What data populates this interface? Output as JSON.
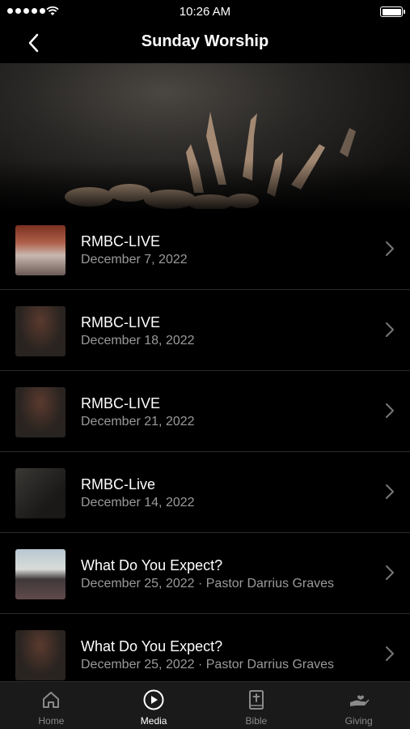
{
  "status": {
    "time": "10:26 AM"
  },
  "nav": {
    "title": "Sunday Worship"
  },
  "items": [
    {
      "title": "RMBC-LIVE",
      "subtitle": "December 7, 2022",
      "thumb": "church"
    },
    {
      "title": "RMBC-LIVE",
      "subtitle": "December 18, 2022",
      "thumb": "lights"
    },
    {
      "title": "RMBC-LIVE",
      "subtitle": "December 21, 2022",
      "thumb": "lights"
    },
    {
      "title": "RMBC-Live",
      "subtitle": "December 14, 2022",
      "thumb": "hands"
    },
    {
      "title": "What Do You Expect?",
      "subtitle": "December 25, 2022 · Pastor Darrius Graves",
      "thumb": "stage"
    },
    {
      "title": "What Do You Expect?",
      "subtitle": "December 25, 2022 · Pastor Darrius Graves",
      "thumb": "lights"
    }
  ],
  "tabs": [
    {
      "label": "Home",
      "icon": "home-icon",
      "active": false
    },
    {
      "label": "Media",
      "icon": "play-circle-icon",
      "active": true
    },
    {
      "label": "Bible",
      "icon": "bible-icon",
      "active": false
    },
    {
      "label": "Giving",
      "icon": "giving-hand-icon",
      "active": false
    }
  ],
  "colors": {
    "background": "#000000",
    "subtitle": "#9a9a9a",
    "tabbar": "#1a1a1a",
    "tab_inactive": "#8a8a8a"
  }
}
